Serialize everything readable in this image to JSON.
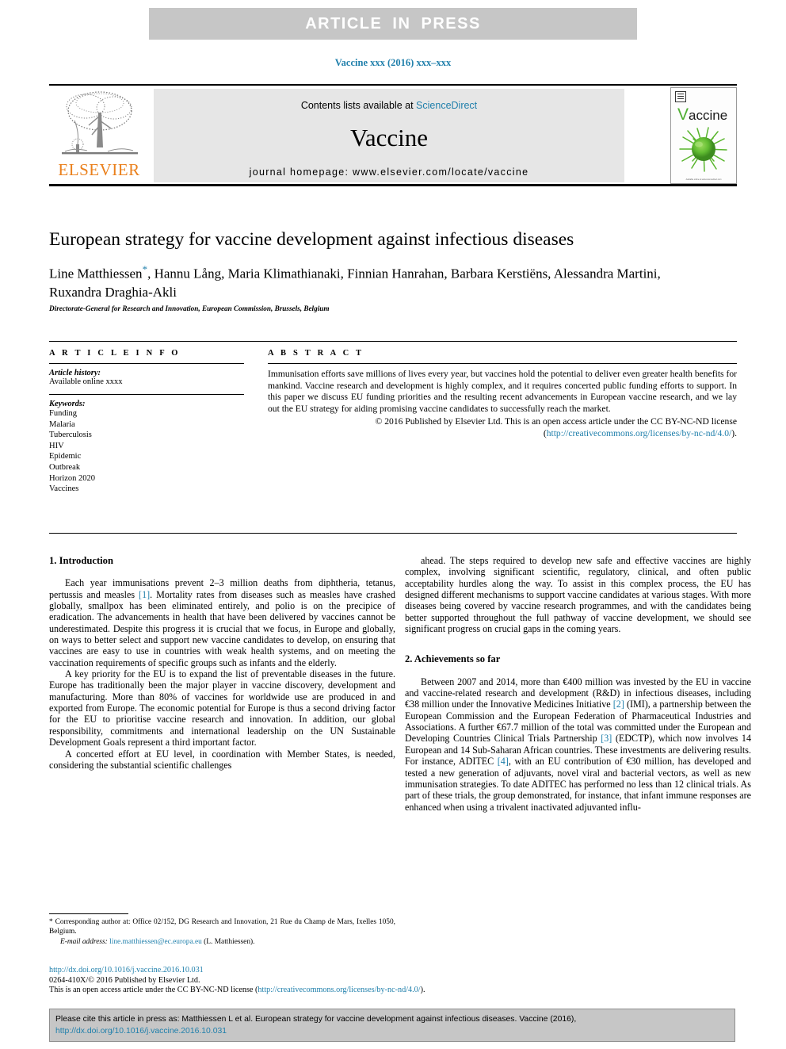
{
  "banner": {
    "text": "ARTICLE  IN  PRESS"
  },
  "journal_ref": "Vaccine xxx (2016) xxx–xxx",
  "masthead": {
    "contents_prefix": "Contents lists available at ",
    "sciencedirect": "ScienceDirect",
    "journal_title": "Vaccine",
    "homepage": "journal homepage: www.elsevier.com/locate/vaccine",
    "publisher_wordmark": "ELSEVIER",
    "cover": {
      "title_initial": "V",
      "title_rest": "accine",
      "caption": "Available online at www.sciencedirect.com"
    }
  },
  "article": {
    "title": "European strategy for vaccine development against infectious diseases",
    "authors": "Line Matthiessen",
    "authors_rest": ", Hannu Lång, Maria Klimathianaki, Finnian Hanrahan, Barbara Kerstiëns, Alessandra Martini, Ruxandra Draghia-Akli",
    "corresponding_marker": "*",
    "affiliation": "Directorate-General for Research and Innovation, European Commission, Brussels, Belgium"
  },
  "info": {
    "heading": "A R T I C L E  I N F O",
    "history_label": "Article history:",
    "history_value": "Available online xxxx",
    "keywords_label": "Keywords:",
    "keywords": [
      "Funding",
      "Malaria",
      "Tuberculosis",
      "HIV",
      "Epidemic",
      "Outbreak",
      "Horizon 2020",
      "Vaccines"
    ]
  },
  "abstract": {
    "heading": "A B S T R A C T",
    "text": "Immunisation efforts save millions of lives every year, but vaccines hold the potential to deliver even greater health benefits for mankind. Vaccine research and development is highly complex, and it requires concerted public funding efforts to support. In this paper we discuss EU funding priorities and the resulting recent advancements in European vaccine research, and we lay out the EU strategy for aiding promising vaccine candidates to successfully reach the market.",
    "copyright_prefix": "© 2016 Published by Elsevier Ltd. This is an open access article under the CC BY-NC-ND license (",
    "copyright_link": "http://creativecommons.org/licenses/by-nc-nd/4.0/",
    "copyright_suffix": ")."
  },
  "body": {
    "left": {
      "section1_heading": "1. Introduction",
      "p1_a": "Each year immunisations prevent 2–3 million deaths from diphtheria, tetanus, pertussis and measles ",
      "p1_ref": "[1]",
      "p1_b": ". Mortality rates from diseases such as measles have crashed globally, smallpox has been eliminated entirely, and polio is on the precipice of eradication. The advancements in health that have been delivered by vaccines cannot be underestimated. Despite this progress it is crucial that we focus, in Europe and globally, on ways to better select and support new vaccine candidates to develop, on ensuring that vaccines are easy to use in countries with weak health systems, and on meeting the vaccination requirements of specific groups such as infants and the elderly.",
      "p2": "A key priority for the EU is to expand the list of preventable diseases in the future. Europe has traditionally been the major player in vaccine discovery, development and manufacturing. More than 80% of vaccines for worldwide use are produced in and exported from Europe. The economic potential for Europe is thus a second driving factor for the EU to prioritise vaccine research and innovation. In addition, our global responsibility, commitments and international leadership on the UN Sustainable Development Goals represent a third important factor.",
      "p3": "A concerted effort at EU level, in coordination with Member States, is needed, considering the substantial scientific challenges"
    },
    "right": {
      "p1": "ahead. The steps required to develop new safe and effective vaccines are highly complex, involving significant scientific, regulatory, clinical, and often public acceptability hurdles along the way. To assist in this complex process, the EU has designed different mechanisms to support vaccine candidates at various stages. With more diseases being covered by vaccine research programmes, and with the candidates being better supported throughout the full pathway of vaccine development, we should see significant progress on crucial gaps in the coming years.",
      "section2_heading": "2. Achievements so far",
      "p2_a": "Between 2007 and 2014, more than €400 million was invested by the EU in vaccine and vaccine-related research and development (R&D) in infectious diseases, including €38 million under the Innovative Medicines Initiative ",
      "p2_ref1": "[2]",
      "p2_b": " (IMI), a partnership between the European Commission and the European Federation of Pharmaceutical Industries and Associations. A further €67.7 million of the total was committed under the European and Developing Countries Clinical Trials Partnership ",
      "p2_ref2": "[3]",
      "p2_c": " (EDCTP), which now involves 14 European and 14 Sub-Saharan African countries. These investments are delivering results. For instance, ADITEC ",
      "p2_ref3": "[4]",
      "p2_d": ", with an EU contribution of €30 million, has developed and tested a new generation of adjuvants, novel viral and bacterial vectors, as well as new immunisation strategies. To date ADITEC has performed no less than 12 clinical trials. As part of these trials, the group demonstrated, for instance, that infant immune responses are enhanced when using a trivalent inactivated adjuvanted influ-"
    }
  },
  "footnote": {
    "marker": "*",
    "corresponding": " Corresponding author at: Office 02/152, DG Research and Innovation, 21 Rue du Champ de Mars, Ixelles 1050, Belgium.",
    "email_label": "E-mail address:",
    "email": "line.matthiessen@ec.europa.eu",
    "email_owner": "(L. Matthiessen)."
  },
  "publication": {
    "doi": "http://dx.doi.org/10.1016/j.vaccine.2016.10.031",
    "issn_line": "0264-410X/© 2016 Published by Elsevier Ltd.",
    "license_prefix": "This is an open access article under the CC BY-NC-ND license (",
    "license_link": "http://creativecommons.org/licenses/by-nc-nd/4.0/",
    "license_suffix": ")."
  },
  "citation_box": {
    "prefix": "Please cite this article in press as: Matthiessen L et al. European strategy for vaccine development against infectious diseases. Vaccine (2016), ",
    "link": "http://dx.doi.org/10.1016/j.vaccine.2016.10.031"
  },
  "colors": {
    "link_blue": "#1f7fab",
    "banner_gray": "#c6c6c6",
    "elsevier_orange": "#ea801c",
    "cover_green": "#4fae32"
  }
}
